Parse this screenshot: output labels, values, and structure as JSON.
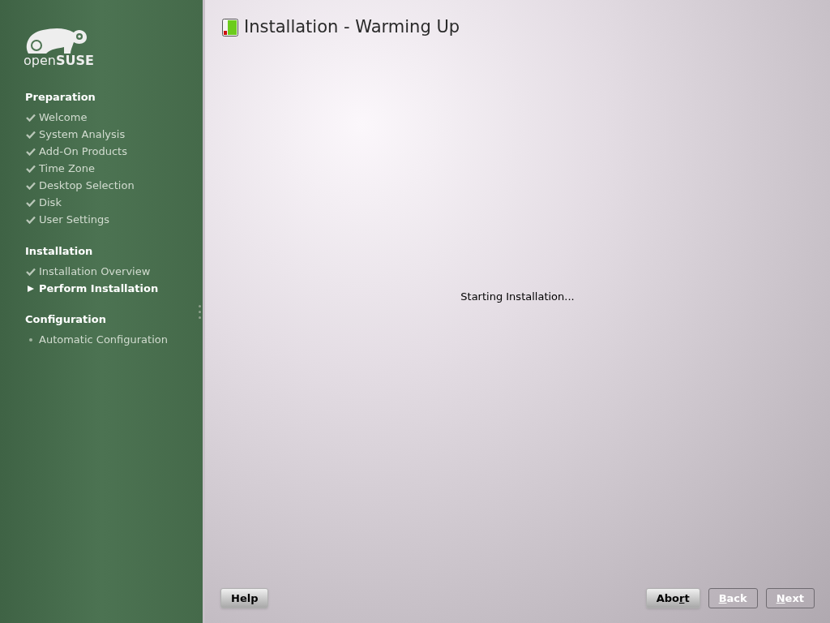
{
  "logo": {
    "text": "open**SUSE**"
  },
  "sidebar": {
    "sections": [
      {
        "title": "Preparation",
        "items": [
          {
            "label": "Welcome",
            "kind": "done"
          },
          {
            "label": "System Analysis",
            "kind": "done"
          },
          {
            "label": "Add-On Products",
            "kind": "done"
          },
          {
            "label": "Time Zone",
            "kind": "done"
          },
          {
            "label": "Desktop Selection",
            "kind": "done"
          },
          {
            "label": "Disk",
            "kind": "done"
          },
          {
            "label": "User Settings",
            "kind": "done"
          }
        ]
      },
      {
        "title": "Installation",
        "items": [
          {
            "label": "Installation Overview",
            "kind": "done"
          },
          {
            "label": "Perform Installation",
            "kind": "current"
          }
        ]
      },
      {
        "title": "Configuration",
        "items": [
          {
            "label": "Automatic Configuration",
            "kind": "pending"
          }
        ]
      }
    ]
  },
  "header": {
    "title": "Installation - Warming Up"
  },
  "status": "Starting Installation...",
  "buttons_left": [
    {
      "label": "Help",
      "disabled": false
    }
  ],
  "buttons_right": [
    {
      "before": "Abo",
      "underlined": "r",
      "after": "t",
      "disabled": false
    },
    {
      "underlined": "B",
      "after": "ack",
      "disabled": true
    },
    {
      "underlined": "N",
      "after": "ext",
      "disabled": true
    }
  ]
}
